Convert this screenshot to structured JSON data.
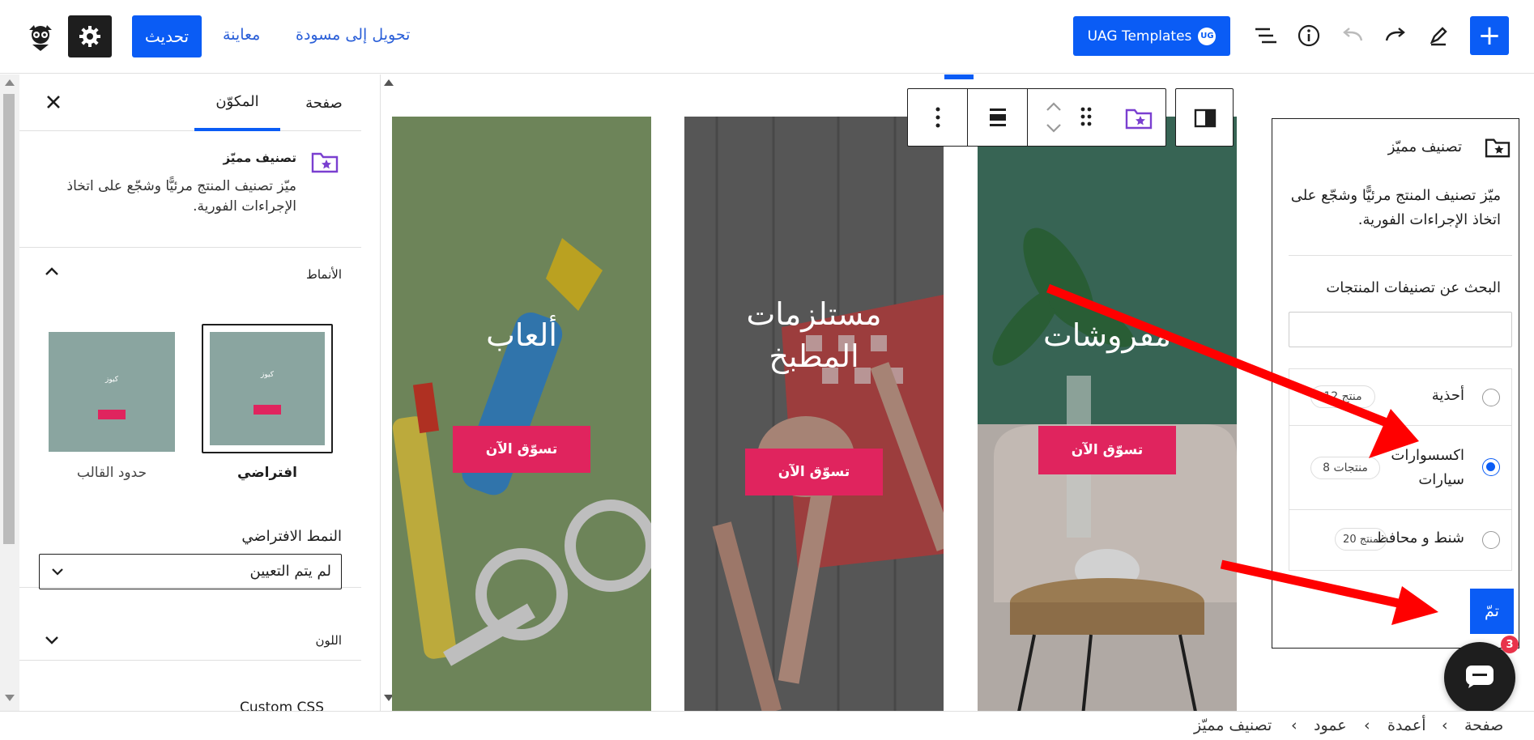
{
  "topbar": {
    "add_label": "+",
    "uag_label": "UAG Templates",
    "uag_badge": "UG",
    "switch_draft": "تحويل إلى مسودة",
    "preview": "معاينة",
    "update": "تحديث"
  },
  "sidebar": {
    "tabs": [
      "صفحة",
      "المكوّن"
    ],
    "block_title": "تصنيف مميّز",
    "block_desc": "ميّز تصنيف المنتج مرئيًّا وشجّع على اتخاذ الإجراءات الفورية.",
    "styles_heading": "الأنماط",
    "style_default": "افتراضي",
    "style_border": "حدود القالب",
    "thumb_title": "كيوز",
    "default_style_label": "النمط الافتراضي",
    "default_style_value": "لم يتم التعيين",
    "color_heading": "اللون",
    "custom_css": "Custom CSS"
  },
  "canvas": {
    "columns": [
      {
        "title": "مفروشات",
        "button": "تسوّق الآن",
        "bg": "#3d6b58"
      },
      {
        "title": "مستلزمات المطبخ",
        "button": "تسوّق الآن",
        "bg": "#5a5a5a"
      },
      {
        "title": "ألعاب",
        "button": "تسوّق الآن",
        "bg": "#7f9b67"
      }
    ]
  },
  "popup": {
    "title": "تصنيف مميّز",
    "desc": "ميّز تصنيف المنتج مرئيًّا وشجّع على اتخاذ الإجراءات الفورية.",
    "search_label": "البحث عن تصنيفات المنتجات",
    "search_value": "",
    "options": [
      {
        "label": "أحذية",
        "count": "12 منتج",
        "selected": false
      },
      {
        "label": "اكسسوارات سيارات",
        "count": "8 منتجات",
        "selected": true
      },
      {
        "label": "شنط و محافظ",
        "count": "20 منتج",
        "selected": false
      }
    ],
    "done_label": "تمّ"
  },
  "chat": {
    "badge": "3"
  },
  "breadcrumb": [
    "صفحة",
    "أعمدة",
    "عمود",
    "تصنيف مميّز"
  ],
  "colors": {
    "accent": "#0a5cf5",
    "shop_button": "#e0245e",
    "arrow": "#ff0000",
    "purple_icon": "#7a3fd0"
  }
}
